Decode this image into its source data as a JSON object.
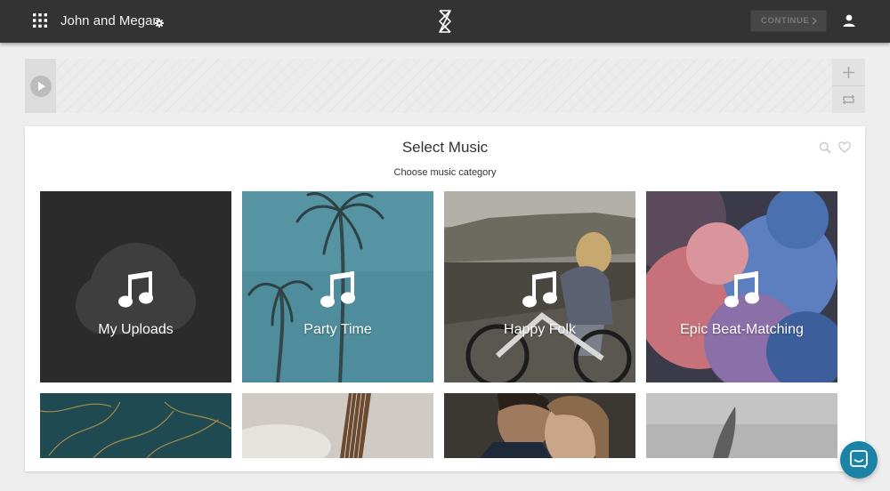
{
  "header": {
    "project_title": "John and Megan",
    "continue_label": "CONTINUE"
  },
  "icons": {
    "apps": "apps-grid-icon",
    "settings": "gear-icon",
    "logo": "brand-logo",
    "user": "user-icon",
    "play": "play-icon",
    "add": "plus-icon",
    "repeat": "repeat-icon",
    "search": "search-icon",
    "favorite": "heart-icon",
    "music": "music-note-icon",
    "chat": "chat-icon"
  },
  "music_panel": {
    "title": "Select Music",
    "subtitle": "Choose music category",
    "categories": [
      {
        "label": "My Uploads"
      },
      {
        "label": "Party Time"
      },
      {
        "label": "Happy Folk"
      },
      {
        "label": "Epic Beat-Matching"
      }
    ]
  },
  "colors": {
    "topbar": "#333333",
    "background": "#eeeeee",
    "panel": "#ffffff",
    "chat_accent": "#1b83a5"
  }
}
